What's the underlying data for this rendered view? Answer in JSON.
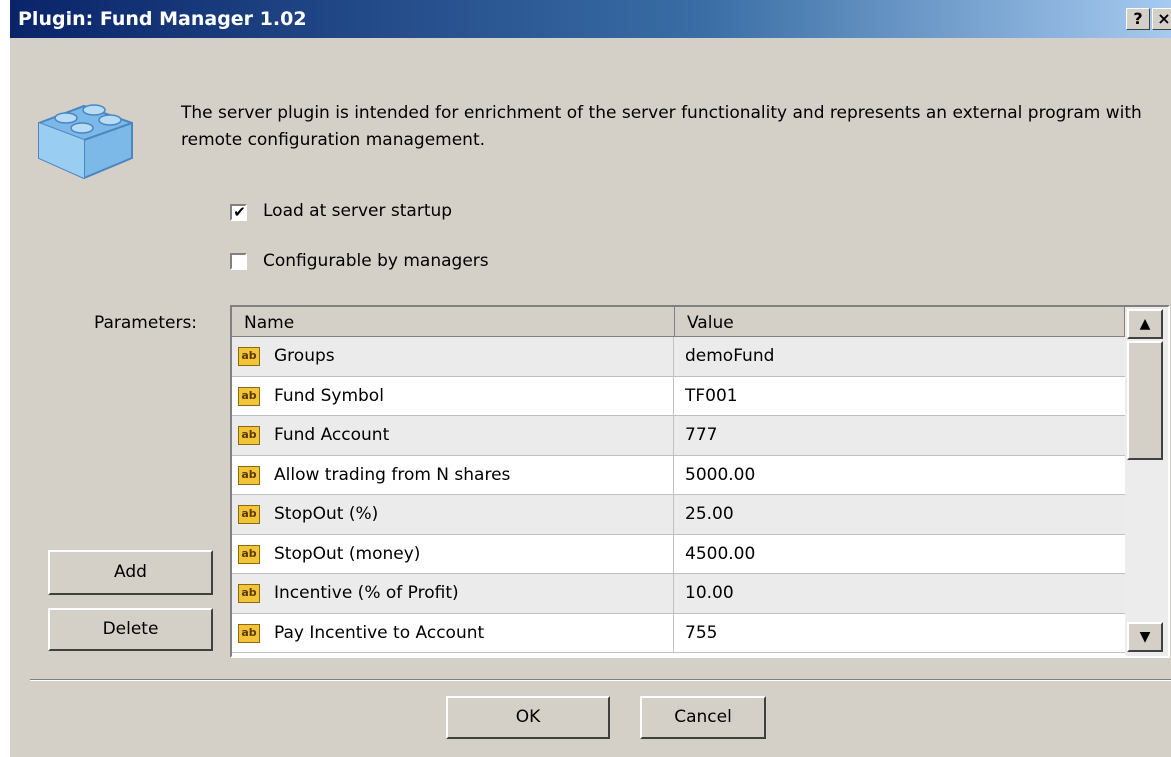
{
  "window": {
    "title": "Plugin: Fund Manager 1.02",
    "help_label": "?",
    "close_label": "×"
  },
  "description": "The server plugin is intended for enrichment of the server functionality and represents an external program with remote configuration management.",
  "options": {
    "load_at_startup": {
      "label": "Load at server startup",
      "checked": true
    },
    "configurable_by_managers": {
      "label": "Configurable by managers",
      "checked": false
    }
  },
  "parameters": {
    "label": "Parameters:",
    "columns": [
      "Name",
      "Value"
    ],
    "icon_text": "ab",
    "rows": [
      {
        "name": "Groups",
        "value": "demoFund"
      },
      {
        "name": "Fund Symbol",
        "value": "TF001"
      },
      {
        "name": "Fund Account",
        "value": "777"
      },
      {
        "name": "Allow trading from N shares",
        "value": "5000.00"
      },
      {
        "name": "StopOut (%)",
        "value": "25.00"
      },
      {
        "name": "StopOut (money)",
        "value": "4500.00"
      },
      {
        "name": "Incentive (% of Profit)",
        "value": "10.00"
      },
      {
        "name": "Pay Incentive to Account",
        "value": "755"
      }
    ]
  },
  "buttons": {
    "add": "Add",
    "delete": "Delete",
    "ok": "OK",
    "cancel": "Cancel"
  },
  "icons": {
    "plugin": "lego-brick-icon",
    "row": "text-param-icon",
    "scroll_up": "arrow-up-icon",
    "scroll_down": "arrow-down-icon"
  }
}
